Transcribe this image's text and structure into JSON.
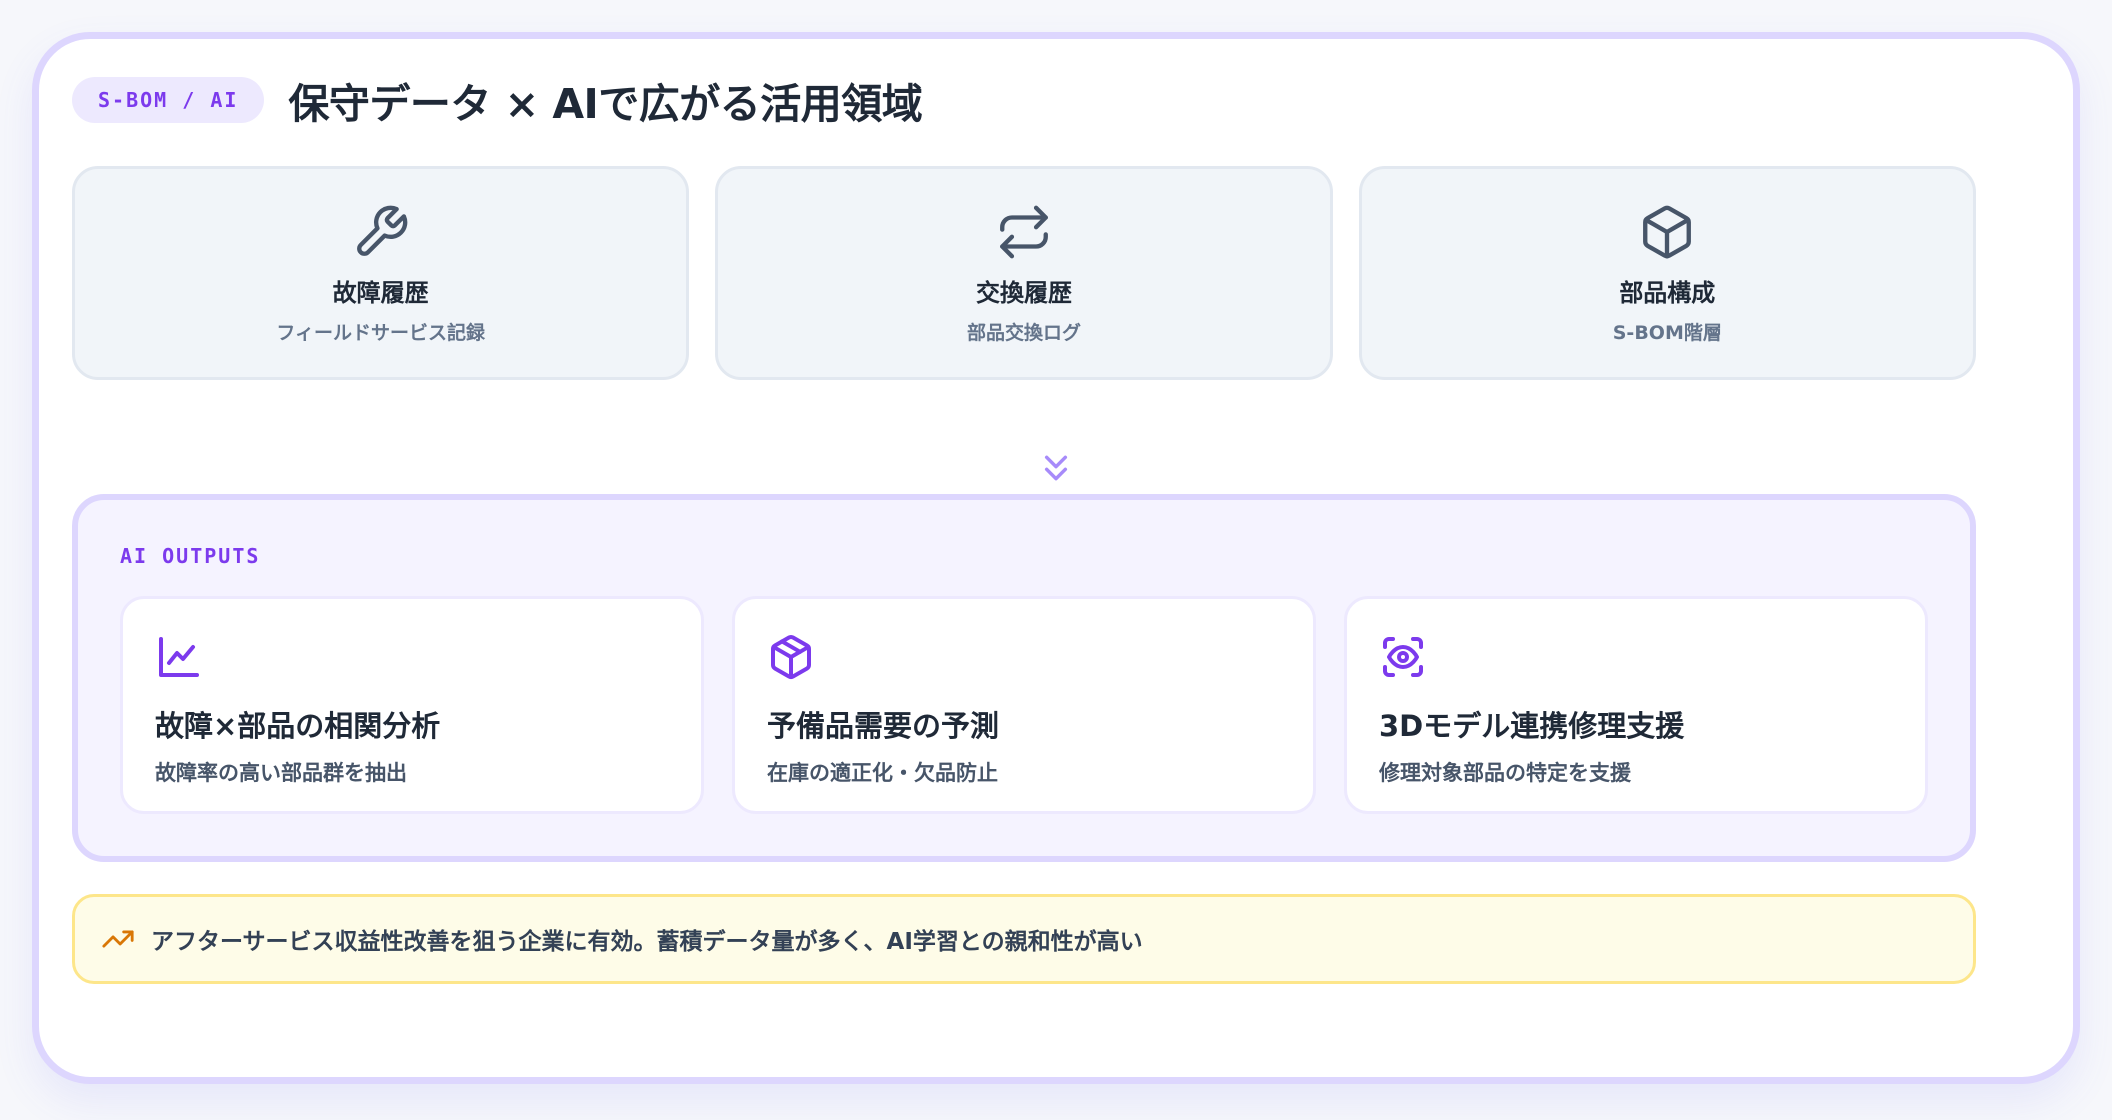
{
  "header": {
    "tag": "S-BOM / AI",
    "title": "保守データ × AIで広がる活用領域"
  },
  "sources": [
    {
      "icon": "wrench-icon",
      "name": "故障履歴",
      "sub": "フィールドサービス記録"
    },
    {
      "icon": "swap-arrows-icon",
      "name": "交換履歴",
      "sub": "部品交換ログ"
    },
    {
      "icon": "box-icon",
      "name": "部品構成",
      "sub": "S-BOM階層"
    }
  ],
  "outputs": {
    "label": "AI OUTPUTS",
    "items": [
      {
        "icon": "line-chart-icon",
        "name": "故障×部品の相関分析",
        "sub": "故障率の高い部品群を抽出"
      },
      {
        "icon": "package-icon",
        "name": "予備品需要の予測",
        "sub": "在庫の適正化・欠品防止"
      },
      {
        "icon": "eye-scan-icon",
        "name": "3Dモデル連携修理支援",
        "sub": "修理対象部品の特定を支援"
      }
    ]
  },
  "note": {
    "icon": "trending-up-icon",
    "text": "アフターサービス収益性改善を狙う企業に有効。蓄積データ量が多く、AI学習との親和性が高い"
  },
  "colors": {
    "accent": "#7c3aed",
    "accent_light": "#ddd6fe",
    "source_bg": "#f1f5f9",
    "note_bg": "#fefce8",
    "note_icon": "#d97706"
  }
}
